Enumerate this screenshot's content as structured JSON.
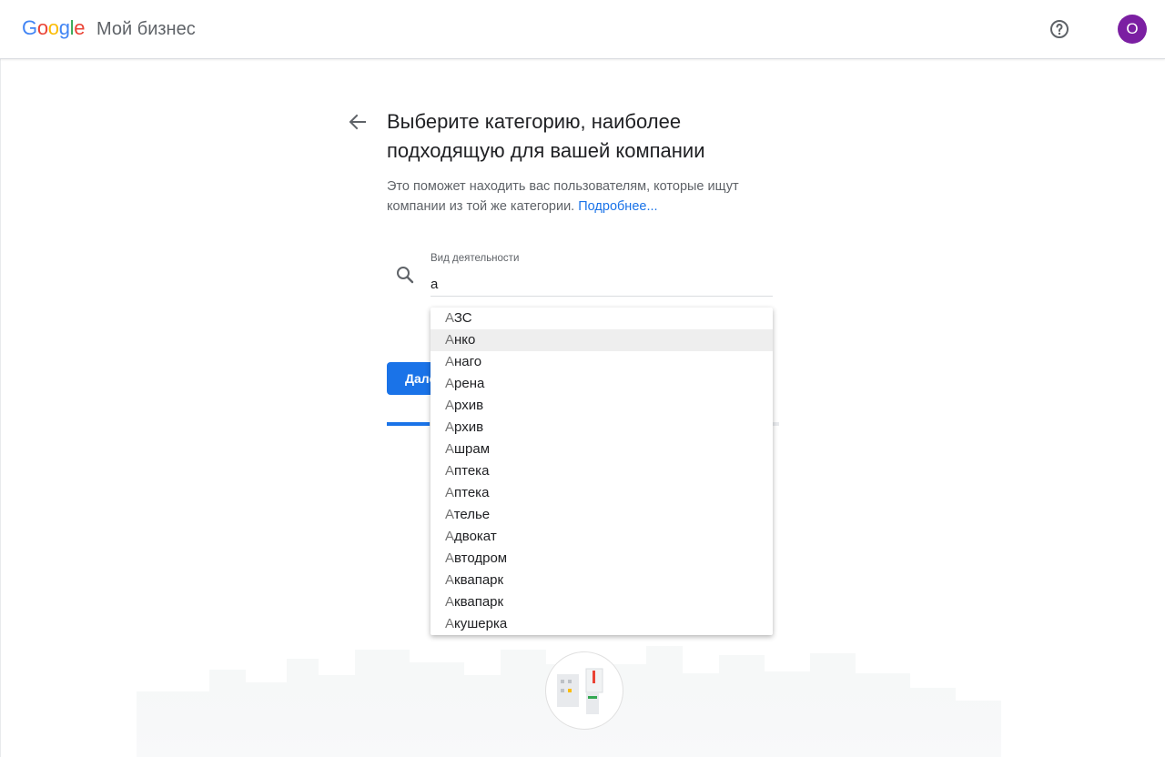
{
  "header": {
    "logo_letters": [
      {
        "ch": "G",
        "color": "#4285F4"
      },
      {
        "ch": "o",
        "color": "#EA4335"
      },
      {
        "ch": "o",
        "color": "#FBBC05"
      },
      {
        "ch": "g",
        "color": "#4285F4"
      },
      {
        "ch": "l",
        "color": "#34A853"
      },
      {
        "ch": "e",
        "color": "#EA4335"
      }
    ],
    "product_name": "Мой бизнес",
    "help_icon": "help-circle-icon",
    "avatar_letter": "O",
    "avatar_color": "#7b1fa2"
  },
  "main": {
    "title": "Выберите категорию, наиболее подходящую для вашей компании",
    "subtitle": "Это поможет находить вас пользователям, которые ищут компании из той же категории.",
    "learn_more": "Подробнее...",
    "field_label": "Вид деятельности",
    "field_value": "а",
    "next_button": "Далее",
    "progress_percent": 11
  },
  "dropdown": {
    "highlighted_index": 1,
    "items": [
      {
        "match": "А",
        "rest": "ЗС"
      },
      {
        "match": "А",
        "rest": "нко"
      },
      {
        "match": "А",
        "rest": "наго"
      },
      {
        "match": "А",
        "rest": "рена"
      },
      {
        "match": "А",
        "rest": "рхив"
      },
      {
        "match": "А",
        "rest": "рхив"
      },
      {
        "match": "А",
        "rest": "шрам"
      },
      {
        "match": "А",
        "rest": "птека"
      },
      {
        "match": "А",
        "rest": "птека"
      },
      {
        "match": "А",
        "rest": "телье"
      },
      {
        "match": "А",
        "rest": "двокат"
      },
      {
        "match": "А",
        "rest": "втодром"
      },
      {
        "match": "А",
        "rest": "квапарк"
      },
      {
        "match": "А",
        "rest": "квапарк"
      },
      {
        "match": "А",
        "rest": "кушерка"
      }
    ]
  },
  "colors": {
    "accent": "#1a73e8",
    "link": "#1a73e8"
  }
}
